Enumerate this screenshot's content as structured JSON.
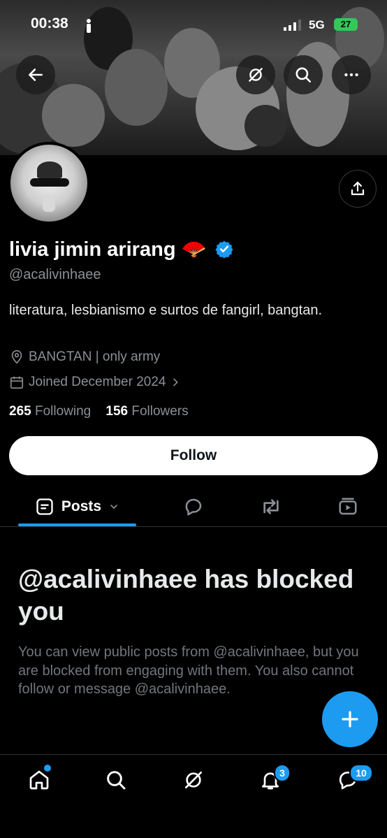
{
  "status_bar": {
    "time": "00:38",
    "network": "5G",
    "battery": "27"
  },
  "header": {
    "icons": [
      "back-arrow-icon",
      "grok-icon",
      "search-icon",
      "more-icon"
    ]
  },
  "profile": {
    "display_name": "livia jimin arirang 🪭",
    "handle": "@acalivinhaee",
    "bio": "literatura, lesbianismo e surtos de fangirl, bangtan.",
    "location": "BANGTAN | only army",
    "joined": "Joined December 2024",
    "following_count": "265",
    "following_label": "Following",
    "followers_count": "156",
    "followers_label": "Followers",
    "verified_color": "#1d9bf0"
  },
  "follow_button": {
    "label": "Follow"
  },
  "tabs": [
    {
      "label": "Posts",
      "icon": "posts-icon",
      "active": true
    },
    {
      "label": "",
      "icon": "replies-icon"
    },
    {
      "label": "",
      "icon": "reposts-icon"
    },
    {
      "label": "",
      "icon": "media-icon"
    }
  ],
  "blocked": {
    "title": "@acalivinhaee has blocked you",
    "body": "You can view public posts from @acalivinhaee, but you are blocked from engaging with them. You also cannot follow or message @acalivinhaee."
  },
  "bottom_nav": {
    "notifications_badge": "3",
    "messages_badge": "10",
    "accent": "#1d9bf0"
  }
}
